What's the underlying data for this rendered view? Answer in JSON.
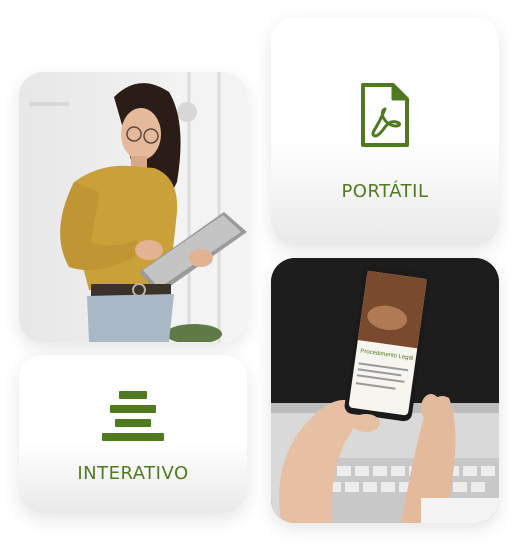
{
  "features": [
    {
      "label": "PORTÁTIL",
      "icon": "pdf-file-icon"
    },
    {
      "label": "INTERATIVO",
      "icon": "layered-bars-icon"
    }
  ],
  "photos": [
    {
      "subject": "woman-with-tablet-photo"
    },
    {
      "subject": "hand-holding-phone-photo"
    }
  ],
  "phone_screen": {
    "heading": "Procedimento Legal"
  },
  "colors": {
    "accent": "#4f7a1f",
    "card_bg": "#ffffff"
  }
}
